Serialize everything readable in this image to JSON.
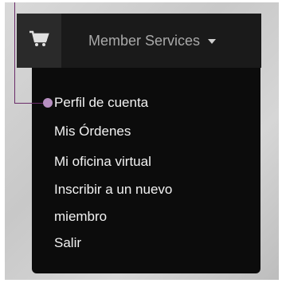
{
  "header": {
    "cart_icon": "shopping-cart-icon",
    "member_label": "Member Services",
    "dropdown_icon": "caret-down-icon"
  },
  "menu": {
    "items": [
      {
        "label": "Perfil de cuenta"
      },
      {
        "label": "Mis Órdenes"
      },
      {
        "label": "Mi oficina virtual"
      },
      {
        "label": "Inscribir a un nuevo miembro"
      },
      {
        "label": "Salir"
      }
    ]
  },
  "colors": {
    "bar": "#1a1a1a",
    "dropdown": "#0c0c0c",
    "callout": "#b78fc1"
  }
}
